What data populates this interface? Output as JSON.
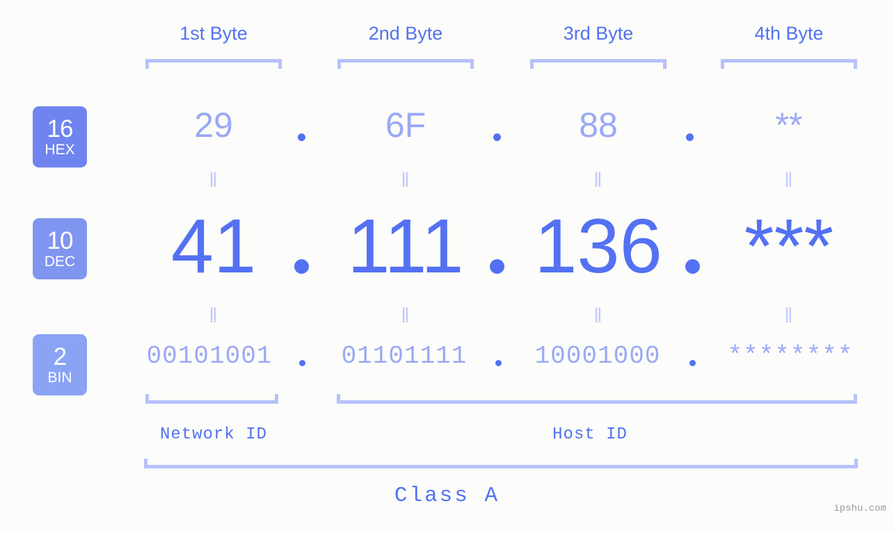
{
  "background_color": "#fcfdfa",
  "accent_colors": {
    "strong_blue": "#5371f2",
    "mid_blue": "#9aa8f6",
    "light_blue": "#b7c0fb",
    "pale_blue": "#c3cbfc",
    "badge_hex": "#6f84ee",
    "badge_dec": "#8095f0",
    "badge_bin": "#8aa3f5",
    "watermark_gray": "#9b9b9b"
  },
  "byte_headers": [
    {
      "label": "1st Byte"
    },
    {
      "label": "2nd Byte"
    },
    {
      "label": "3rd Byte"
    },
    {
      "label": "4th Byte"
    }
  ],
  "base_badges": [
    {
      "number": "16",
      "abbr": "HEX"
    },
    {
      "number": "10",
      "abbr": "DEC"
    },
    {
      "number": "2",
      "abbr": "BIN"
    }
  ],
  "rows": {
    "hex": {
      "base": "16",
      "values": [
        "29",
        "6F",
        "88",
        "**"
      ],
      "separator": "."
    },
    "dec": {
      "base": "10",
      "values": [
        "41",
        "111",
        "136",
        "***"
      ],
      "separator": "."
    },
    "bin": {
      "base": "2",
      "values": [
        "00101001",
        "01101111",
        "10001000",
        "********"
      ],
      "separator": "."
    }
  },
  "equals_marks": {
    "glyph": "‖",
    "count_per_row": 4
  },
  "id_labels": [
    {
      "label": "Network ID"
    },
    {
      "label": "Host ID"
    }
  ],
  "class_label": "Class A",
  "watermark": "ipshu.com",
  "chart_data": {
    "type": "table",
    "title": "IP address byte breakdown",
    "columns": [
      "1st Byte",
      "2nd Byte",
      "3rd Byte",
      "4th Byte"
    ],
    "rows": [
      {
        "base": "16 HEX",
        "cells": [
          "29",
          "6F",
          "88",
          "**"
        ]
      },
      {
        "base": "10 DEC",
        "cells": [
          "41",
          "111",
          "136",
          "***"
        ]
      },
      {
        "base": "2 BIN",
        "cells": [
          "00101001",
          "01101111",
          "10001000",
          "********"
        ]
      }
    ],
    "groupings": [
      {
        "label": "Network ID",
        "bytes": [
          1
        ]
      },
      {
        "label": "Host ID",
        "bytes": [
          2,
          3,
          4
        ]
      },
      {
        "label": "Class A",
        "bytes": [
          1,
          2,
          3,
          4
        ]
      }
    ]
  }
}
